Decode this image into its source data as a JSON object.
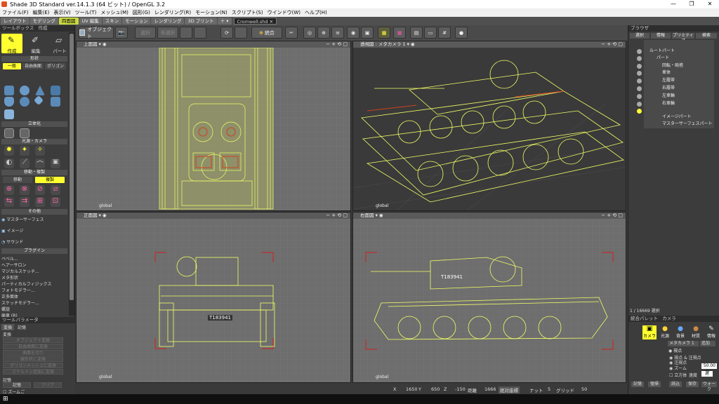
{
  "window": {
    "title": "Shade 3D Standard ver.14.1.3 (64 ビット) / OpenGL 3.2",
    "controls": [
      "—",
      "❐",
      "✕"
    ]
  },
  "menu": [
    "ファイル(F)",
    "編集(E)",
    "表示(V)",
    "ツール(T)",
    "メッシュ(M)",
    "図形(G)",
    "レンダリング(R)",
    "モーション(N)",
    "スクリプト(S)",
    "ウインドウ(W)",
    "ヘルプ(H)"
  ],
  "main_tabs": [
    "レイアウト",
    "モデリング",
    "四面図",
    "UV 編集",
    "スキン",
    "モーション",
    "レンダリング",
    "3D プリント",
    "＋ ▾"
  ],
  "active_tab": "四面図",
  "file_tab": "Cromwell.shd ✕",
  "toolbar": {
    "object_label": "オブジェクト",
    "rotate_label": "回転",
    "merge_label": "統合",
    "disabled1": "選択",
    "disabled2": "非選択"
  },
  "toolbox": {
    "title": "ツールボックス",
    "title2": "作成",
    "modes": [
      "作成",
      "編集",
      "パート"
    ],
    "section_shape": "形状",
    "shape_buttons": [
      "一般",
      "自由曲面",
      "ポリゴン"
    ],
    "section_solid": "立体化",
    "section_light": "光源・カメラ",
    "section_move": "移動・複製",
    "move_buttons": [
      "移動",
      "複製"
    ],
    "section_other": "その他",
    "other_items": [
      "マスターサーフェス",
      "イメージ",
      "サウンド"
    ],
    "section_plugin": "プラグイン",
    "plugins": [
      "ベベル...",
      "ヘアーサロン",
      "マジカルスケッチ...",
      "メタ形状",
      "パーティカルフィジックス",
      "フォトモデラー...",
      "正多面体",
      "スケッチモデラー...",
      "螺旋",
      "歯車 (R)"
    ]
  },
  "params": {
    "title": "ツールパラメータ",
    "tabs": [
      "変換",
      "記憶"
    ],
    "section": "変換",
    "buttons": [
      "オブジェクト変換",
      "自由曲面に変換",
      "曲面を切り",
      "線形状に変換",
      "ポリゴンメッシュに変換",
      "スケルトン追加に変換"
    ],
    "memory_label": "記憶",
    "memory_buttons": [
      "記憶",
      "クリア"
    ],
    "zoom_label": "ズームご"
  },
  "viewports": [
    {
      "label": "上面図",
      "coord": "global"
    },
    {
      "label": "透視図 : メタカメラ 1",
      "coord": "global"
    },
    {
      "label": "正面図",
      "coord": "global"
    },
    {
      "label": "右面図",
      "coord": "global"
    }
  ],
  "tank_labels": {
    "front_plate": "T183941",
    "side_plate": "T183941"
  },
  "browser": {
    "title": "ブラウザ",
    "tabs": [
      "選択",
      "情報",
      "プリミティブ",
      "検索"
    ],
    "items": [
      "ルートパート",
      "パート",
      "回転・砲塔",
      "車体",
      "左履帯",
      "右履帯",
      "左車輪",
      "右車輪",
      "イメージパート",
      "マスターサーフェスパート"
    ],
    "footer": "1 / 16669 選択"
  },
  "palette": {
    "title": "統合パレット",
    "title2": "カメラ",
    "buttons": [
      "カメラ",
      "光源",
      "背景",
      "材質",
      "情報"
    ],
    "camera_name": "メタカメラ 1",
    "camera_opt": "追加",
    "rows": [
      "視点",
      "視点 & 注視点",
      "注視点",
      "ズーム"
    ],
    "zoom_value": "50.00",
    "cube_label": "立方体",
    "speed_label": "速度",
    "speed_value": "遅",
    "bottom": [
      "記憶",
      "復帰",
      "読込",
      "保存",
      "ウォーク"
    ]
  },
  "status": {
    "x_label": "X",
    "x_value": "1650",
    "y_label": "Y",
    "y_value": "650",
    "z_label": "Z",
    "z_value": "-150",
    "dist_label": "距離",
    "dist_value": "1666",
    "mode_label": "絶対座標",
    "grid_label": "ナット",
    "grid_value": "5",
    "snap_label": "グリッド",
    "snap_value": "50"
  },
  "colors": {
    "wire": "#f2ff66",
    "accent": "#ffff00",
    "red_guide": "#d02020",
    "panel": "#3c3c3c"
  }
}
